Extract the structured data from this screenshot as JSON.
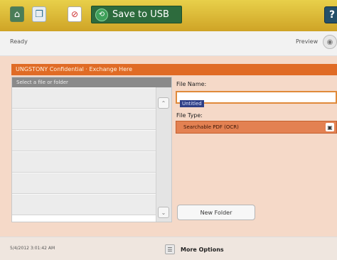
{
  "toolbar": {
    "home_icon": "home-icon",
    "copy_icon": "copy-icon",
    "stop_icon": "stop-icon",
    "usb_icon": "usb-icon",
    "save_label": "Save to USB",
    "help_label": "?"
  },
  "status": {
    "text": "Ready",
    "preview_label": "Preview"
  },
  "panel": {
    "title": "UNGSTONY Confidential · Exchange Here"
  },
  "file_list": {
    "header": "Select a file or folder",
    "rows": [
      "",
      "",
      "",
      "",
      "",
      ""
    ]
  },
  "file_name": {
    "label": "File Name:",
    "value": "Untitled"
  },
  "file_type": {
    "label": "File Type:",
    "value": "Searchable PDF (OCR)"
  },
  "new_folder_label": "New Folder",
  "footer": {
    "timestamp": "5/4/2012 3:01:42 AM",
    "more_options": "More Options"
  },
  "colors": {
    "toolbar": "#d8b634",
    "panel_title": "#e06b25",
    "file_type_highlight": "#e38152",
    "save_button": "#2d6b3d"
  }
}
